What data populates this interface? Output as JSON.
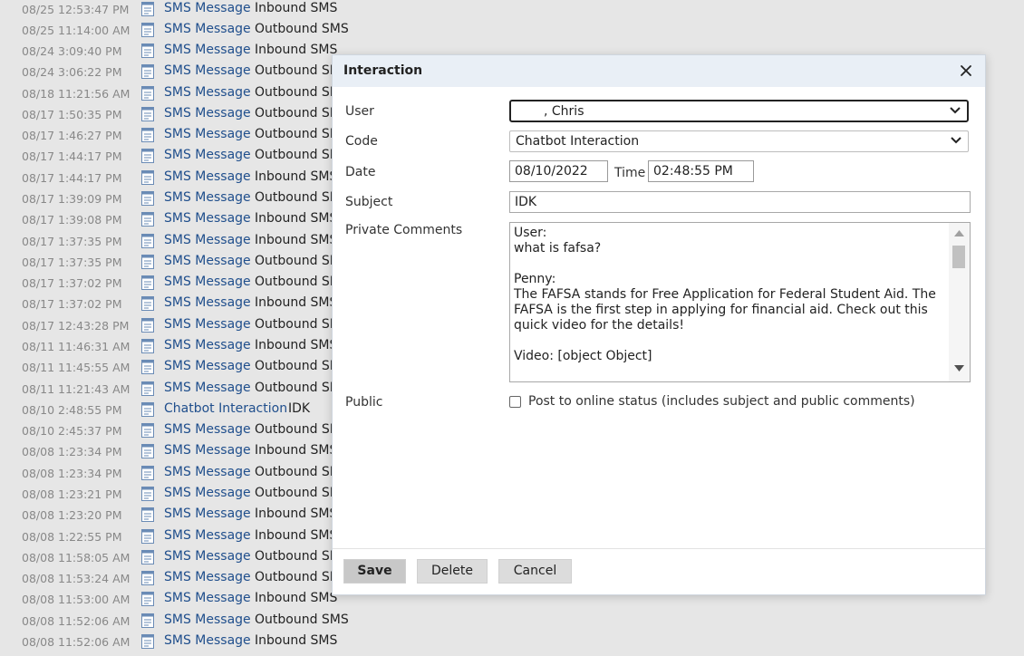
{
  "background_list": {
    "rows": [
      {
        "date": "08/25 12:53:47 PM",
        "link": "SMS Message",
        "type": "Inbound SMS"
      },
      {
        "date": "08/25 11:14:00 AM",
        "link": "SMS Message",
        "type": "Outbound SMS"
      },
      {
        "date": "08/24 3:09:40 PM",
        "link": "SMS Message",
        "type": "Inbound SMS"
      },
      {
        "date": "08/24 3:06:22 PM",
        "link": "SMS Message",
        "type": "Outbound SMS"
      },
      {
        "date": "08/18 11:21:56 AM",
        "link": "SMS Message",
        "type": "Outbound SMS"
      },
      {
        "date": "08/17 1:50:35 PM",
        "link": "SMS Message",
        "type": "Outbound SMS"
      },
      {
        "date": "08/17 1:46:27 PM",
        "link": "SMS Message",
        "type": "Outbound SMS"
      },
      {
        "date": "08/17 1:44:17 PM",
        "link": "SMS Message",
        "type": "Outbound SMS"
      },
      {
        "date": "08/17 1:44:17 PM",
        "link": "SMS Message",
        "type": "Inbound SMS"
      },
      {
        "date": "08/17 1:39:09 PM",
        "link": "SMS Message",
        "type": "Outbound SMS"
      },
      {
        "date": "08/17 1:39:08 PM",
        "link": "SMS Message",
        "type": "Inbound SMS"
      },
      {
        "date": "08/17 1:37:35 PM",
        "link": "SMS Message",
        "type": "Inbound SMS"
      },
      {
        "date": "08/17 1:37:35 PM",
        "link": "SMS Message",
        "type": "Outbound SMS"
      },
      {
        "date": "08/17 1:37:02 PM",
        "link": "SMS Message",
        "type": "Outbound SMS"
      },
      {
        "date": "08/17 1:37:02 PM",
        "link": "SMS Message",
        "type": "Inbound SMS"
      },
      {
        "date": "08/17 12:43:28 PM",
        "link": "SMS Message",
        "type": "Outbound SMS"
      },
      {
        "date": "08/11 11:46:31 AM",
        "link": "SMS Message",
        "type": "Inbound SMS"
      },
      {
        "date": "08/11 11:45:55 AM",
        "link": "SMS Message",
        "type": "Outbound SMS"
      },
      {
        "date": "08/11 11:21:43 AM",
        "link": "SMS Message",
        "type": "Outbound SMS"
      },
      {
        "date": "08/10 2:48:55 PM",
        "link": "Chatbot Interaction",
        "type": "IDK"
      },
      {
        "date": "08/10 2:45:37 PM",
        "link": "SMS Message",
        "type": "Outbound SMS"
      },
      {
        "date": "08/08 1:23:34 PM",
        "link": "SMS Message",
        "type": "Inbound SMS"
      },
      {
        "date": "08/08 1:23:34 PM",
        "link": "SMS Message",
        "type": "Outbound SMS"
      },
      {
        "date": "08/08 1:23:21 PM",
        "link": "SMS Message",
        "type": "Outbound SMS"
      },
      {
        "date": "08/08 1:23:20 PM",
        "link": "SMS Message",
        "type": "Inbound SMS"
      },
      {
        "date": "08/08 1:22:55 PM",
        "link": "SMS Message",
        "type": "Inbound SMS"
      },
      {
        "date": "08/08 11:58:05 AM",
        "link": "SMS Message",
        "type": "Outbound SMS"
      },
      {
        "date": "08/08 11:53:24 AM",
        "link": "SMS Message",
        "type": "Outbound SMS"
      },
      {
        "date": "08/08 11:53:00 AM",
        "link": "SMS Message",
        "type": "Inbound SMS"
      },
      {
        "date": "08/08 11:52:06 AM",
        "link": "SMS Message",
        "type": "Outbound SMS"
      },
      {
        "date": "08/08 11:52:06 AM",
        "link": "SMS Message",
        "type": "Inbound SMS"
      }
    ]
  },
  "dialog": {
    "title": "Interaction",
    "close_icon": "close-icon",
    "fields": {
      "user": {
        "label": "User",
        "value": ", Chris"
      },
      "code": {
        "label": "Code",
        "value": "Chatbot Interaction"
      },
      "date": {
        "label": "Date",
        "value": "08/10/2022"
      },
      "time": {
        "label": "Time",
        "value": "02:48:55 PM"
      },
      "subject": {
        "label": "Subject",
        "value": "IDK"
      },
      "comments": {
        "label": "Private Comments",
        "lines": [
          "User:",
          "what is fafsa?",
          "",
          "Penny:",
          "The FAFSA stands for Free Application for Federal Student Aid. The FAFSA is the first step in applying for financial aid. Check out this quick video for the details!",
          "",
          "Video: [object Object]"
        ]
      },
      "public": {
        "label": "Public",
        "checkbox_text": "Post to online status (includes subject and public comments)",
        "checked": false
      }
    },
    "buttons": {
      "save": "Save",
      "delete": "Delete",
      "cancel": "Cancel"
    }
  },
  "colors": {
    "link": "#1f4e8c",
    "dialog_header": "#e9eff6",
    "page_background": "#e6e6e6"
  }
}
